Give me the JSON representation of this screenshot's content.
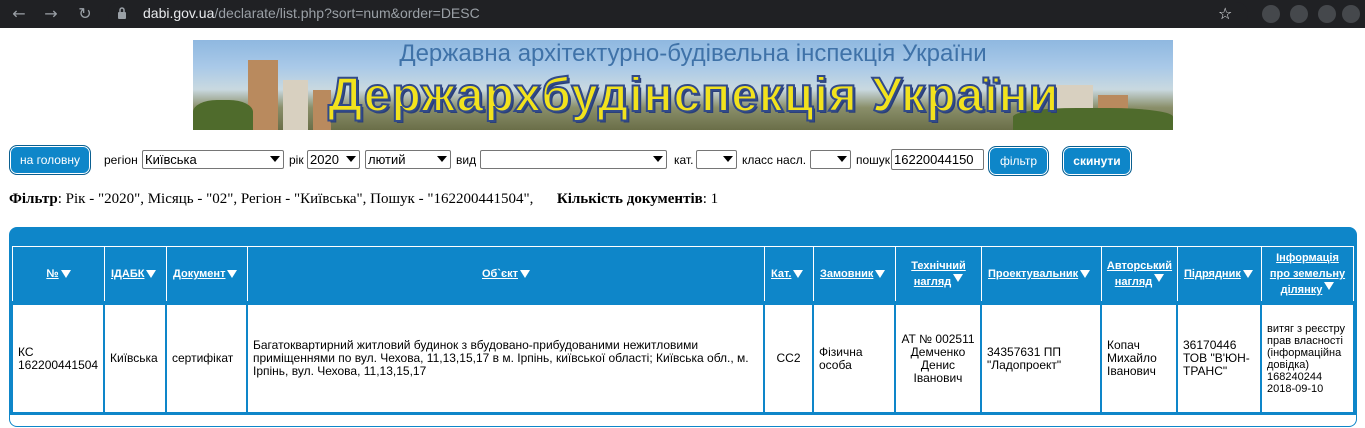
{
  "browser": {
    "url_host": "dabi.gov.ua",
    "url_path": "/declarate/list.php?sort=num&order=DESC"
  },
  "banner": {
    "top_text": "Державна архітектурно-будівельна інспекція України",
    "main_text": "Держархбудінспекція України"
  },
  "filters": {
    "home_button": "на головну",
    "region_label": "регіон",
    "region_value": "Київська",
    "year_label": "рік",
    "year_value": "2020",
    "month_value": "лютий",
    "kind_label": "вид",
    "kind_value": "",
    "cat_label": "кат.",
    "cat_value": "",
    "class_label": "класс насл.",
    "class_value": "",
    "search_label": "пошук",
    "search_value": "16220044150",
    "filter_button": "фільтр",
    "reset_button": "скинути"
  },
  "filter_info": {
    "filter_label": "Фільтр",
    "filter_text": ": Рік - \"2020\", Місяць - \"02\", Регіон - \"Київська\", Пошук - \"162200441504\",",
    "count_label": "Кількість документів",
    "count_text": ": 1"
  },
  "table": {
    "headers": {
      "num": "№",
      "idabk": "ІДАБК",
      "document": "Документ",
      "object": "Об`єкт",
      "cat": "Кат.",
      "customer": "Замовник",
      "tech_supervision_1": "Технічний",
      "tech_supervision_2": "нагляд",
      "designer": "Проектувальник",
      "author_supervision_1": "Авторський",
      "author_supervision_2": "нагляд",
      "contractor": "Підрядник",
      "land_info_1": "Інформація",
      "land_info_2": "про земельну",
      "land_info_3": "ділянку"
    },
    "row": {
      "num": "КС 162200441504",
      "idabk": "Київська",
      "document": "сертифікат",
      "object": "Багатоквартирний житловий будинок з вбудовано-прибудованими нежитловими приміщеннями по вул. Чехова, 11,13,15,17 в м. Ірпінь, київської області; Київська обл., м. Ірпінь, вул. Чехова, 11,13,15,17",
      "cat": "СС2",
      "customer": "Фізична особа",
      "tech_supervision": "АТ № 002511 Демченко Денис Іванович",
      "designer": "34357631 ПП \"Ладопроект\"",
      "author_supervision": "Копач Михайло Іванович",
      "contractor": "36170446 ТОВ \"В'ЮН-ТРАНС\"",
      "land_info": "витяг з реєстру прав власності (інформаційна довідка) 168240244 2018-09-10"
    }
  },
  "colors": {
    "accent": "#0e86c9",
    "chrome": "#202124",
    "banner_title": "#f2e21d"
  }
}
